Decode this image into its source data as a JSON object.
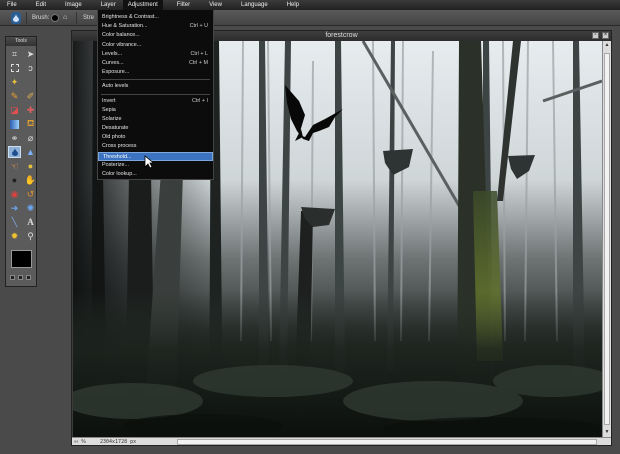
{
  "menu": [
    "File",
    "Edit",
    "Image",
    "Layer",
    "Adjustment",
    "Filter",
    "View",
    "Language",
    "Help"
  ],
  "options": {
    "brush_label": "Brush:",
    "strength_label": "Stre"
  },
  "tools": {
    "title": "Tools"
  },
  "document": {
    "title": "forestcrow",
    "zoom": "%",
    "zoom_arrows": "«‹",
    "size": "2304x1728 px"
  },
  "adjustment_menu": {
    "items": [
      {
        "label": "Brightness & Contrast...",
        "shortcut": ""
      },
      {
        "label": "Hue & Saturation...",
        "shortcut": "Ctrl + U"
      },
      {
        "label": "Color balance...",
        "shortcut": ""
      },
      {
        "label": "Color vibrance...",
        "shortcut": ""
      },
      {
        "label": "Levels...",
        "shortcut": "Ctrl + L"
      },
      {
        "label": "Curves...",
        "shortcut": "Ctrl + M"
      },
      {
        "label": "Exposure...",
        "shortcut": ""
      },
      {
        "label": "Auto levels",
        "shortcut": ""
      },
      {
        "label": "Invert",
        "shortcut": "Ctrl + I"
      },
      {
        "label": "Sepia",
        "shortcut": ""
      },
      {
        "label": "Solarize",
        "shortcut": ""
      },
      {
        "label": "Desaturate",
        "shortcut": ""
      },
      {
        "label": "Old photo",
        "shortcut": ""
      },
      {
        "label": "Cross process",
        "shortcut": ""
      },
      {
        "label": "Threshold...",
        "shortcut": ""
      },
      {
        "label": "Posterize...",
        "shortcut": ""
      },
      {
        "label": "Color lookup...",
        "shortcut": ""
      }
    ],
    "highlighted": "Threshold..."
  },
  "colors": {
    "accent": "#3b73c0",
    "active_tool": "#8fb1d8"
  }
}
